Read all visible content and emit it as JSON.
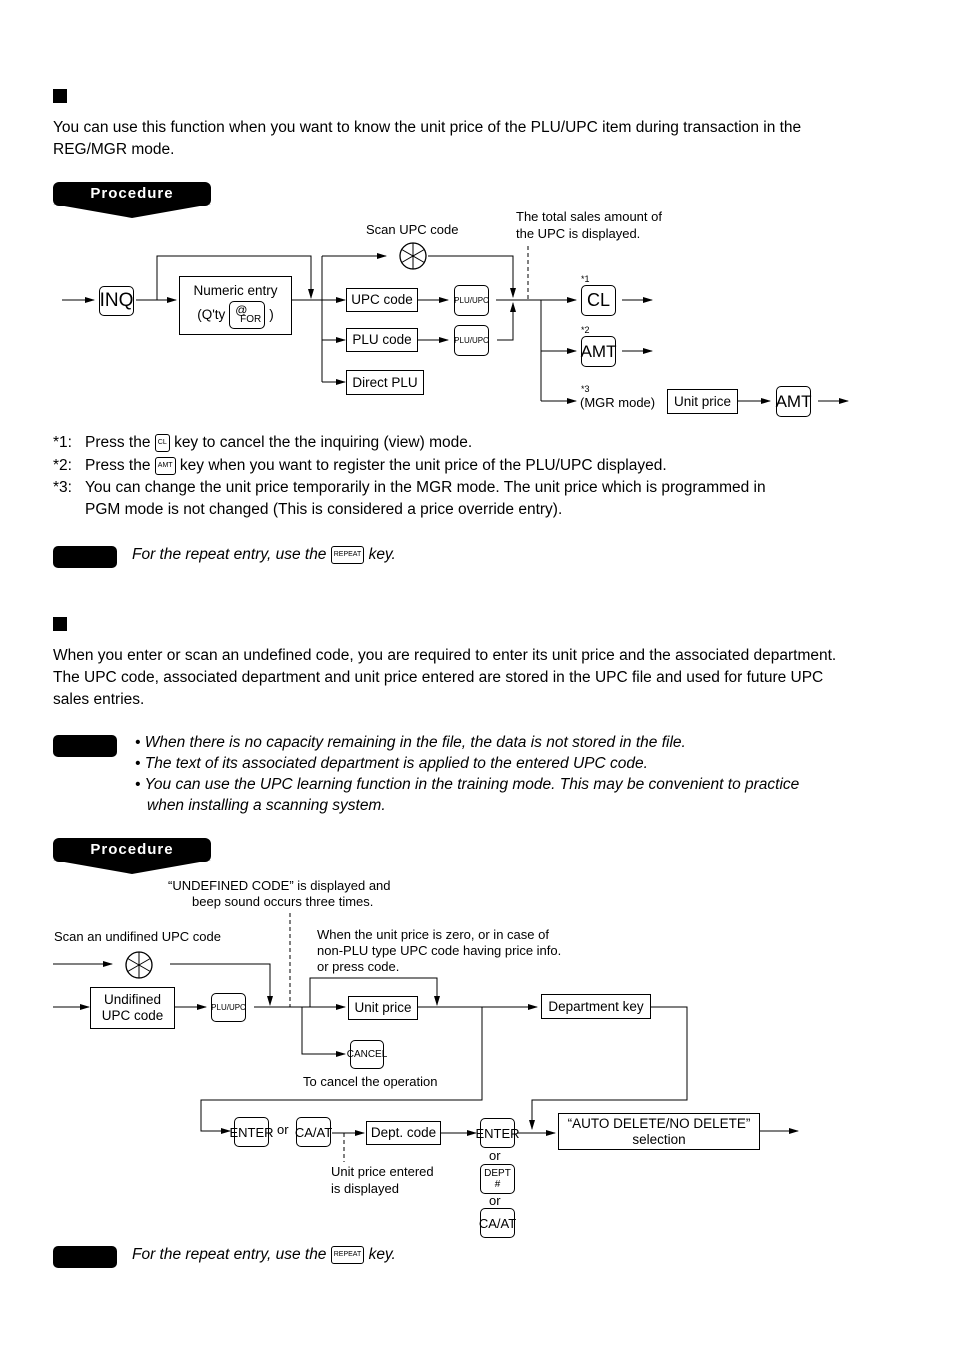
{
  "section1": {
    "intro": "You can use this function when you want to know the unit price of the PLU/UPC item during transaction in the REG/MGR mode.",
    "procedure_label": "Procedure",
    "diagram": {
      "key_inq": "INQ",
      "numeric_entry_line1": "Numeric entry",
      "numeric_entry_line2_prefix": "(Q'ty",
      "numeric_entry_line2_suffix": ")",
      "key_at_for_top": "@",
      "key_at_for_bottom": "FOR",
      "scan_label": "Scan UPC code",
      "total_note_line1": "The total sales amount of",
      "total_note_line2": "the UPC is displayed.",
      "box_upc_code": "UPC code",
      "box_plu_code": "PLU code",
      "box_direct_plu": "Direct PLU",
      "key_plu_upc": "PLU/UPC",
      "mark1": "*1",
      "mark2": "*2",
      "mark3": "*3",
      "key_cl": "CL",
      "key_amt": "AMT",
      "mgr_mode": "(MGR mode)",
      "box_unit_price": "Unit price"
    },
    "footnotes": [
      {
        "mark": "*1:",
        "before": "Press the",
        "key": "CL",
        "after": "key to cancel the the inquiring (view) mode."
      },
      {
        "mark": "*2:",
        "before": "Press the",
        "key": "AMT",
        "after": "key when you want to register the unit price of the PLU/UPC displayed."
      },
      {
        "mark": "*3:",
        "line1": "You can change the unit price temporarily in the MGR mode.  The unit price which is programmed in",
        "line2": "PGM mode is not changed (This is considered a price override entry)."
      }
    ],
    "note": {
      "before": "For the repeat entry, use the",
      "key": "REPEAT",
      "after": "key."
    }
  },
  "section2": {
    "intro": "When you enter or scan an undefined code, you are required to enter its unit price and the associated department.  The UPC code, associated department and unit price entered are stored in the UPC file and used for future UPC sales entries.",
    "notes": [
      "When there is no capacity remaining in the file, the data is not stored in the file.",
      "The text of its associated department is applied to the entered UPC code.",
      "You can use the UPC learning function in the training mode.  This may be convenient to practice when installing a scanning system."
    ],
    "procedure_label": "Procedure",
    "diagram": {
      "undefined_note_line1": "“UNDEFINED CODE” is displayed and",
      "undefined_note_line2": "beep sound occurs three times.",
      "scan_label": "Scan an undifined UPC code",
      "box_undefined_line1": "Undifined",
      "box_undefined_line2": "UPC code",
      "key_plu_upc": "PLU/UPC",
      "zero_note_line1": "When the unit price is zero, or in case of",
      "zero_note_line2": "non-PLU type UPC code having price info.",
      "zero_note_line3": "or press code.",
      "box_unit_price": "Unit price",
      "key_cancel": "CANCEL",
      "cancel_note": "To cancel the operation",
      "box_department_key": "Department key",
      "key_enter": "ENTER",
      "or": "or",
      "key_ca_at": "CA/AT",
      "box_dept_code": "Dept. code",
      "unit_price_note_line1": "Unit price entered",
      "unit_price_note_line2": "is displayed",
      "key_dept_top": "DEPT",
      "key_dept_bottom": "#",
      "box_auto_delete_line1": "“AUTO DELETE/NO DELETE”",
      "box_auto_delete_line2": "selection"
    },
    "note": {
      "before": "For the repeat entry, use the",
      "key": "REPEAT",
      "after": "key."
    }
  }
}
